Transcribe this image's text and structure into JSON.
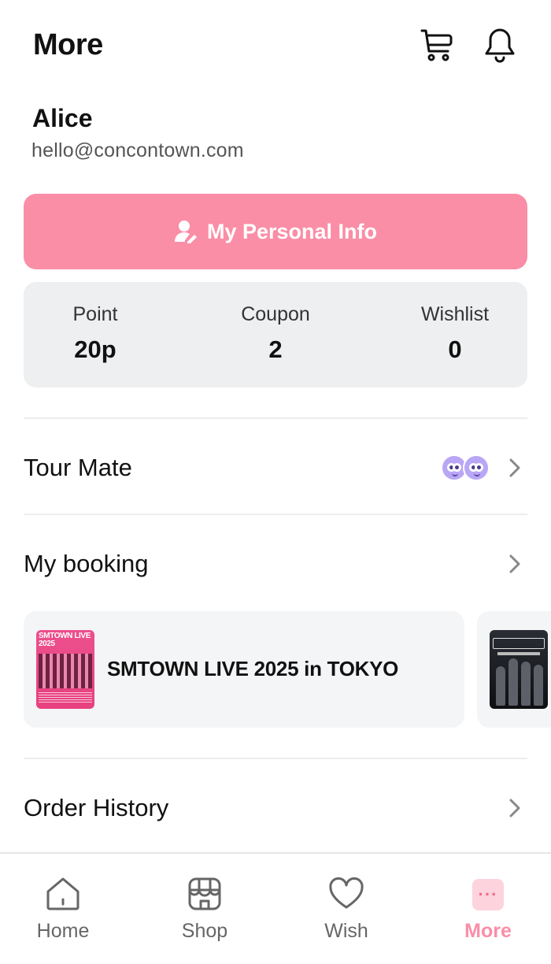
{
  "header": {
    "title": "More",
    "icons": [
      "cart-icon",
      "bell-icon"
    ]
  },
  "profile": {
    "name": "Alice",
    "email": "hello@concontown.com"
  },
  "personal_info": {
    "label": "My Personal Info",
    "icon": "person-edit-icon",
    "color": "#fa8ea6"
  },
  "stats": [
    {
      "label": "Point",
      "value": "20p"
    },
    {
      "label": "Coupon",
      "value": "2"
    },
    {
      "label": "Wishlist",
      "value": "0"
    }
  ],
  "menu": {
    "tour_mate": "Tour Mate",
    "my_booking": "My booking",
    "order_history": "Order History"
  },
  "bookings": [
    {
      "title": "SMTOWN LIVE 2025 in TOKYO",
      "poster_text": "SMTOWN LIVE 2025"
    },
    {
      "title": "",
      "poster_text": ""
    }
  ],
  "bottom_nav": [
    {
      "label": "Home",
      "icon": "home-icon"
    },
    {
      "label": "Shop",
      "icon": "shop-icon"
    },
    {
      "label": "Wish",
      "icon": "heart-icon"
    },
    {
      "label": "More",
      "icon": "more-icon",
      "active": true
    }
  ],
  "colors": {
    "accent": "#fa8ea6",
    "card_bg": "#f4f5f7",
    "stats_bg": "#eeeff1"
  }
}
